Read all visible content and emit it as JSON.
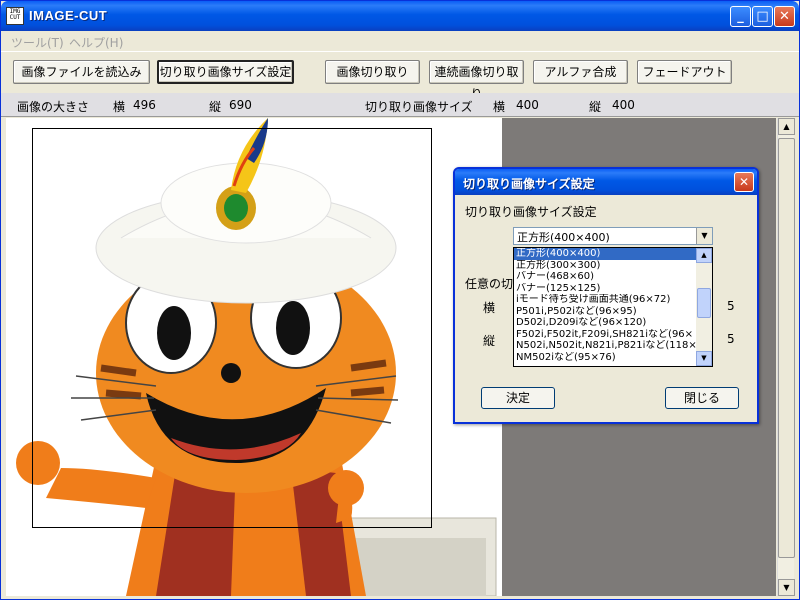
{
  "window": {
    "title": "IMAGE-CUT",
    "icon_text": "IMG CUT",
    "minimize": "_",
    "maximize": "□",
    "close": "✕"
  },
  "menu": [
    "ツール(T)",
    "ヘルプ(H)"
  ],
  "toolbar": {
    "load": "画像ファイルを読込み",
    "crop_size": "切り取り画像サイズ設定",
    "crop": "画像切り取り",
    "continuous_crop": "連続画像切り取り",
    "alpha": "アルファ合成",
    "fade": "フェードアウト"
  },
  "info": {
    "image_size_label": "画像の大きさ",
    "width_label": "横",
    "width_value": "496",
    "height_label": "縦",
    "height_value": "690",
    "crop_size_label": "切り取り画像サイズ",
    "crop_width_label": "横",
    "crop_width_value": "400",
    "crop_height_label": "縦",
    "crop_height_value": "400"
  },
  "dialog": {
    "title": "切り取り画像サイズ設定",
    "section_label": "切り取り画像サイズ設定",
    "custom_label": "任意の切",
    "w_label": "横",
    "h_label": "縦",
    "w_tail": "5",
    "h_tail": "5",
    "selected": "正方形(400×400)",
    "options": [
      "正方形(400×400)",
      "正方形(300×300)",
      "バナー(468×60)",
      "バナー(125×125)",
      "iモード待ち受け画面共通(96×72)",
      "P501i,P502iなど(96×95)",
      "D502i,D209iなど(96×120)",
      "F502i,F502it,F209i,SH821iなど(96×",
      "N502i,N502it,N821i,P821iなど(118×",
      "NM502iなど(95×76)"
    ],
    "ok": "決定",
    "close": "閉じる"
  },
  "colors": {
    "title_blue": "#0058e6",
    "selection": "#316ac5",
    "canvas_bg": "#7d7a78"
  }
}
